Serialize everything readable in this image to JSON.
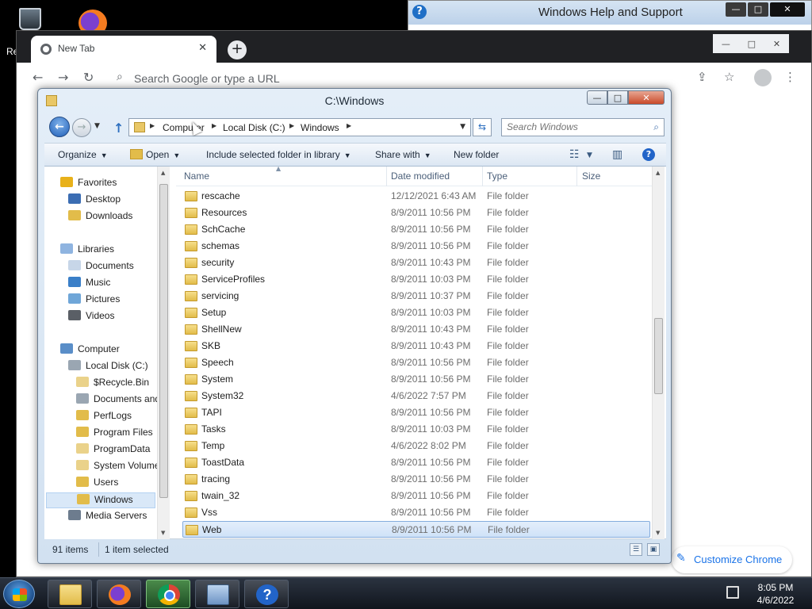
{
  "desktop": {
    "recycle_bin_label": "Re"
  },
  "help_window": {
    "title": "Windows Help and Support",
    "buttons": [
      "—",
      "□",
      "✕"
    ]
  },
  "chrome": {
    "tab_title": "New Tab",
    "tab_close": "✕",
    "new_tab": "+",
    "omnibox_placeholder": "Search Google or type a URL",
    "customize_label": "Customize Chrome",
    "win_buttons": [
      "—",
      "□",
      "✕"
    ]
  },
  "explorer": {
    "title": "C:\\Windows",
    "win_buttons": {
      "min": "—",
      "max": "□",
      "close": "✕"
    },
    "breadcrumb": [
      "Computer",
      "Local Disk (C:)",
      "Windows"
    ],
    "search_placeholder": "Search Windows",
    "toolbar": {
      "organize": "Organize",
      "open": "Open",
      "include": "Include selected folder in library",
      "share": "Share with",
      "new_folder": "New folder",
      "help": "?"
    },
    "columns": {
      "name": "Name",
      "date": "Date modified",
      "type": "Type",
      "size": "Size"
    },
    "nav": [
      {
        "label": "Favorites",
        "icon": "star-icon",
        "color": "#e8b11a",
        "indent": 0
      },
      {
        "label": "Desktop",
        "icon": "desktop-icon",
        "color": "#3b6db3",
        "indent": 1
      },
      {
        "label": "Downloads",
        "icon": "downloads-folder-icon",
        "color": "#e2bc4a",
        "indent": 1
      },
      {
        "label": "Libraries",
        "icon": "libraries-icon",
        "color": "#8fb4e0",
        "indent": 0
      },
      {
        "label": "Documents",
        "icon": "documents-icon",
        "color": "#c7d6e8",
        "indent": 1
      },
      {
        "label": "Music",
        "icon": "music-icon",
        "color": "#3a7fc8",
        "indent": 1
      },
      {
        "label": "Pictures",
        "icon": "pictures-icon",
        "color": "#6fa6d8",
        "indent": 1
      },
      {
        "label": "Videos",
        "icon": "videos-icon",
        "color": "#5a5f66",
        "indent": 1
      },
      {
        "label": "Computer",
        "icon": "computer-icon",
        "color": "#5a8ec8",
        "indent": 0
      },
      {
        "label": "Local Disk (C:)",
        "icon": "drive-icon",
        "color": "#9aa6b2",
        "indent": 1
      },
      {
        "label": "$Recycle.Bin",
        "icon": "folder-icon",
        "color": "#ead28a",
        "indent": 2
      },
      {
        "label": "Documents and",
        "icon": "folder-icon",
        "color": "#9aa6b2",
        "indent": 2
      },
      {
        "label": "PerfLogs",
        "icon": "folder-icon",
        "color": "#e2bc4a",
        "indent": 2
      },
      {
        "label": "Program Files",
        "icon": "folder-icon",
        "color": "#e2bc4a",
        "indent": 2
      },
      {
        "label": "ProgramData",
        "icon": "folder-icon",
        "color": "#ead28a",
        "indent": 2
      },
      {
        "label": "System Volume",
        "icon": "folder-icon",
        "color": "#ead28a",
        "indent": 2
      },
      {
        "label": "Users",
        "icon": "folder-icon",
        "color": "#e2bc4a",
        "indent": 2
      },
      {
        "label": "Windows",
        "icon": "folder-icon",
        "color": "#e2bc4a",
        "indent": 2,
        "selected": true
      },
      {
        "label": "Media Servers",
        "icon": "media-servers-icon",
        "color": "#6d7c8e",
        "indent": 1
      }
    ],
    "files": [
      {
        "name": "rescache",
        "date": "12/12/2021 6:43 AM",
        "type": "File folder"
      },
      {
        "name": "Resources",
        "date": "8/9/2011 10:56 PM",
        "type": "File folder"
      },
      {
        "name": "SchCache",
        "date": "8/9/2011 10:56 PM",
        "type": "File folder"
      },
      {
        "name": "schemas",
        "date": "8/9/2011 10:56 PM",
        "type": "File folder"
      },
      {
        "name": "security",
        "date": "8/9/2011 10:43 PM",
        "type": "File folder"
      },
      {
        "name": "ServiceProfiles",
        "date": "8/9/2011 10:03 PM",
        "type": "File folder"
      },
      {
        "name": "servicing",
        "date": "8/9/2011 10:37 PM",
        "type": "File folder"
      },
      {
        "name": "Setup",
        "date": "8/9/2011 10:03 PM",
        "type": "File folder"
      },
      {
        "name": "ShellNew",
        "date": "8/9/2011 10:43 PM",
        "type": "File folder"
      },
      {
        "name": "SKB",
        "date": "8/9/2011 10:43 PM",
        "type": "File folder"
      },
      {
        "name": "Speech",
        "date": "8/9/2011 10:56 PM",
        "type": "File folder"
      },
      {
        "name": "System",
        "date": "8/9/2011 10:56 PM",
        "type": "File folder"
      },
      {
        "name": "System32",
        "date": "4/6/2022 7:57 PM",
        "type": "File folder"
      },
      {
        "name": "TAPI",
        "date": "8/9/2011 10:56 PM",
        "type": "File folder"
      },
      {
        "name": "Tasks",
        "date": "8/9/2011 10:03 PM",
        "type": "File folder"
      },
      {
        "name": "Temp",
        "date": "4/6/2022 8:02 PM",
        "type": "File folder"
      },
      {
        "name": "ToastData",
        "date": "8/9/2011 10:56 PM",
        "type": "File folder"
      },
      {
        "name": "tracing",
        "date": "8/9/2011 10:56 PM",
        "type": "File folder"
      },
      {
        "name": "twain_32",
        "date": "8/9/2011 10:56 PM",
        "type": "File folder"
      },
      {
        "name": "Vss",
        "date": "8/9/2011 10:56 PM",
        "type": "File folder"
      },
      {
        "name": "Web",
        "date": "8/9/2011 10:56 PM",
        "type": "File folder",
        "selected": true
      }
    ],
    "status": {
      "count": "91 items",
      "selected": "1 item selected"
    }
  },
  "taskbar": {
    "items": [
      {
        "name": "windows-explorer",
        "icon": "folder-icon"
      },
      {
        "name": "firefox",
        "icon": "firefox-icon"
      },
      {
        "name": "chrome",
        "icon": "chrome-icon",
        "active": true
      },
      {
        "name": "control-panel",
        "icon": "control-panel-icon"
      },
      {
        "name": "help-and-support",
        "icon": "help-icon",
        "glyph": "?"
      }
    ],
    "time": "8:05 PM",
    "date": "4/6/2022"
  }
}
